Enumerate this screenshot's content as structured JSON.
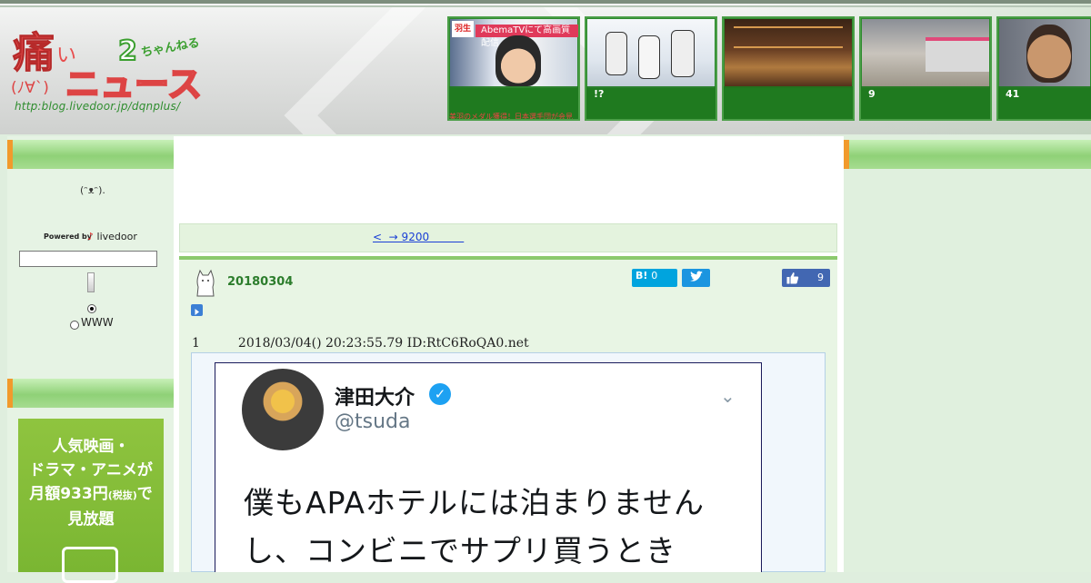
{
  "header": {
    "logo_kanji": "痛",
    "logo_small": "い",
    "logo_face": "(ﾉ∀`)",
    "logo_main": "ニュース",
    "logo_num": "2",
    "logo_chan": "ちゃんねる",
    "logo_url": "http:blog.livedoor.jp/dqnplus/",
    "thumbnails": [
      {
        "caption": "",
        "ticker": "美羽のメダル獲得！日本選手団が会見",
        "banner": "AbemaTVにて高画質配信",
        "corner": "羽生"
      },
      {
        "caption": "!?"
      },
      {
        "caption": ""
      },
      {
        "caption": "9"
      },
      {
        "caption": "41"
      }
    ]
  },
  "sidebar": {
    "face_icon": "(ᵔᴥᵔ)",
    "face_dot": ".",
    "powered_by": "Powered by",
    "livedoor_label": "livedoor",
    "search_placeholder": "",
    "radio_www_label": "WWW",
    "ad": {
      "line1": "人気映画・",
      "line2": "ドラマ・アニメが",
      "line3_pre": "月額933円",
      "line3_small": "(税抜)",
      "line3_post": "で",
      "line4": "見放題"
    }
  },
  "main": {
    "nav_link": "<  → 9200          ",
    "post_title": "20180304",
    "hatena_label": "B!",
    "hatena_count": "0",
    "like_count": "9",
    "comment_number": "1",
    "comment_meta": "2018/03/04() 20:23:55.79 ID:RtC6RoQA0.net",
    "tweet": {
      "name": "津田大介",
      "handle": "@tsuda",
      "line1": "僕もAPAホテルには泊まりません",
      "line2": "し、コンビニでサプリ買うとき"
    }
  },
  "colors": {
    "header_green": "#2d8a2d",
    "bar_orange": "#f19a2c",
    "link_blue": "#1a3fd6",
    "title_green": "#2c7d2c",
    "hatena_blue": "#00a4de",
    "twitter_blue": "#1b95e0",
    "facebook_blue": "#4267b2"
  }
}
